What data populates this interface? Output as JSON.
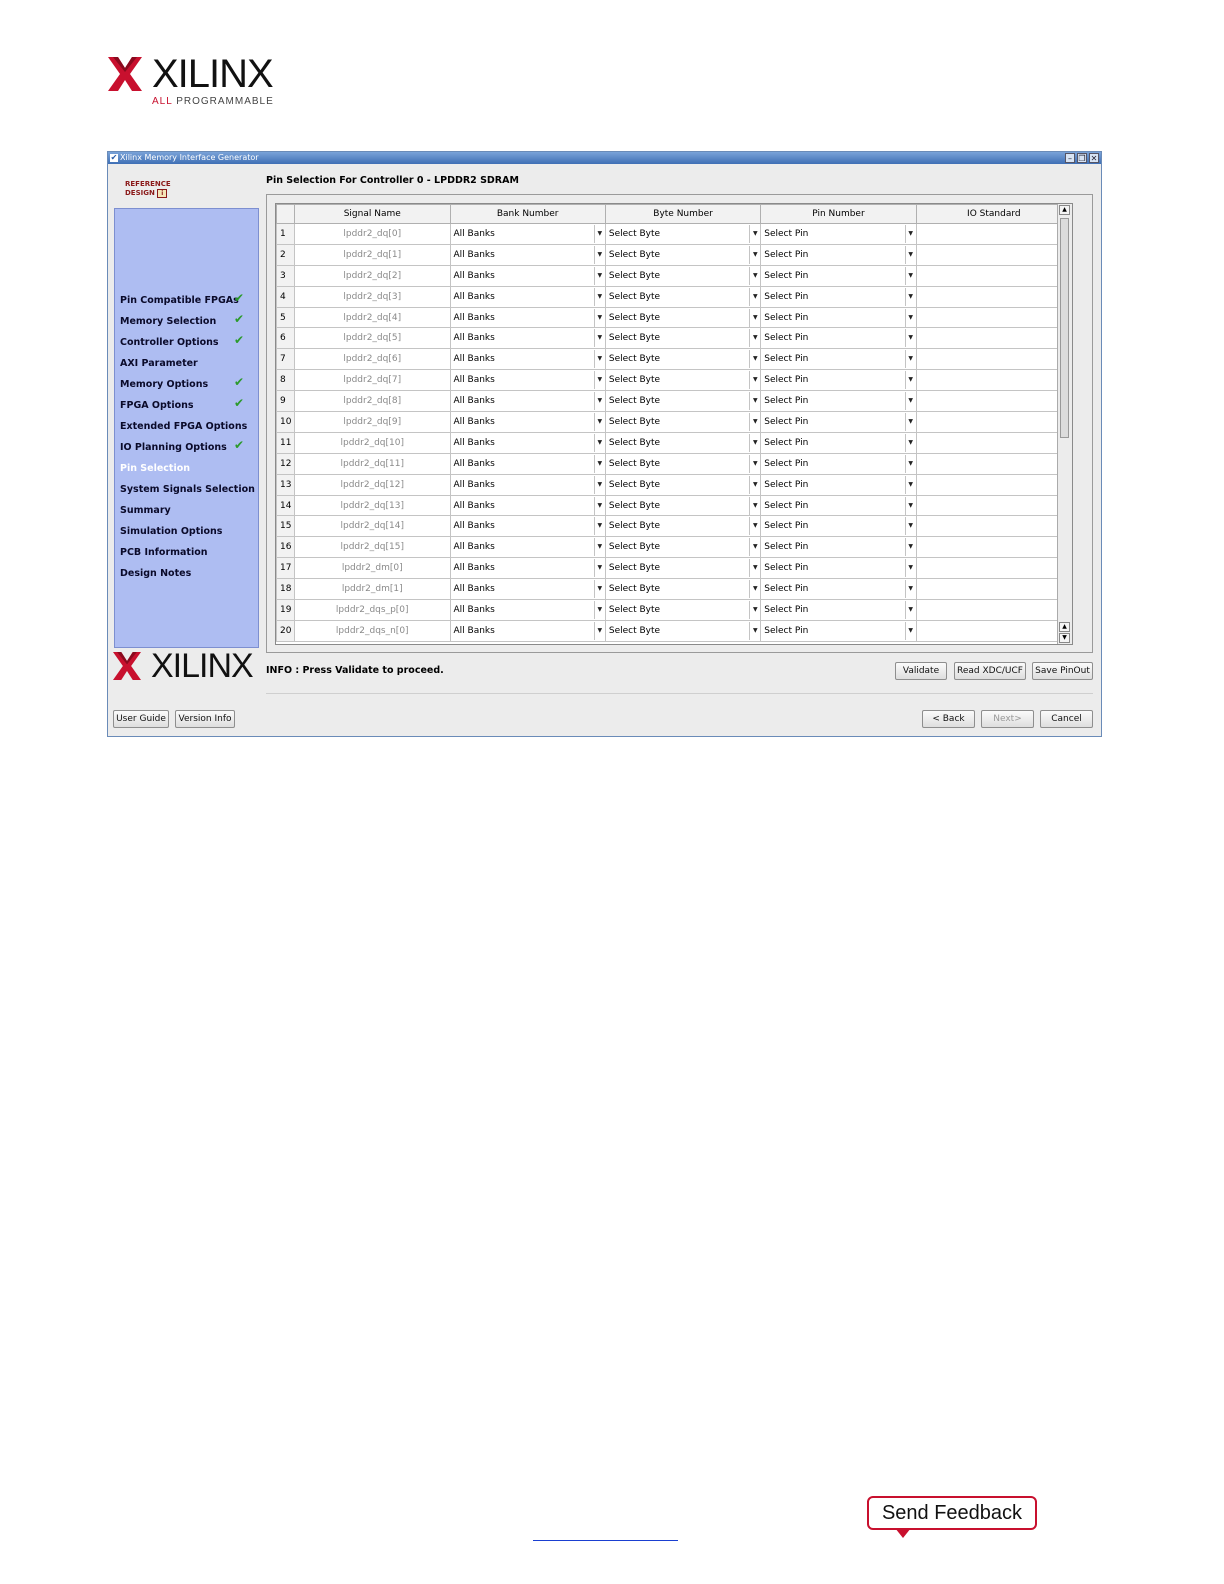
{
  "page": {
    "logo_word": "XILINX",
    "logo_tag_red": "ALL",
    "logo_tag_rest": " PROGRAMMABLE",
    "feedback": "Send Feedback"
  },
  "window": {
    "title": "Xilinx Memory Interface Generator",
    "reference": [
      "REFERENCE",
      "DESIGN"
    ],
    "heading": "Pin Selection For Controller 0 - LPDDR2 SDRAM",
    "info": "INFO : Press Validate to proceed.",
    "logo_word": "XILINX"
  },
  "sidebar": {
    "items": [
      {
        "label": "Pin Compatible FPGAs",
        "done": true
      },
      {
        "label": "Memory Selection",
        "done": true
      },
      {
        "label": "Controller Options",
        "done": true
      },
      {
        "label": "AXI Parameter",
        "done": false
      },
      {
        "label": "Memory Options",
        "done": true
      },
      {
        "label": "FPGA Options",
        "done": true
      },
      {
        "label": "Extended FPGA Options",
        "done": false
      },
      {
        "label": "IO Planning Options",
        "done": true
      },
      {
        "label": "Pin Selection",
        "done": false,
        "current": true
      },
      {
        "label": "System Signals Selection",
        "done": false
      },
      {
        "label": "Summary",
        "done": false
      },
      {
        "label": "Simulation Options",
        "done": false
      },
      {
        "label": "PCB Information",
        "done": false
      },
      {
        "label": "Design Notes",
        "done": false
      }
    ]
  },
  "table": {
    "columns": [
      "",
      "Signal Name",
      "Bank Number",
      "Byte Number",
      "Pin Number",
      "IO Standard"
    ],
    "rows": [
      {
        "num": "1",
        "signal": "lpddr2_dq[0]",
        "bank": "All Banks",
        "byte": "Select Byte",
        "pin": "Select Pin",
        "io": ""
      },
      {
        "num": "2",
        "signal": "lpddr2_dq[1]",
        "bank": "All Banks",
        "byte": "Select Byte",
        "pin": "Select Pin",
        "io": ""
      },
      {
        "num": "3",
        "signal": "lpddr2_dq[2]",
        "bank": "All Banks",
        "byte": "Select Byte",
        "pin": "Select Pin",
        "io": ""
      },
      {
        "num": "4",
        "signal": "lpddr2_dq[3]",
        "bank": "All Banks",
        "byte": "Select Byte",
        "pin": "Select Pin",
        "io": ""
      },
      {
        "num": "5",
        "signal": "lpddr2_dq[4]",
        "bank": "All Banks",
        "byte": "Select Byte",
        "pin": "Select Pin",
        "io": ""
      },
      {
        "num": "6",
        "signal": "lpddr2_dq[5]",
        "bank": "All Banks",
        "byte": "Select Byte",
        "pin": "Select Pin",
        "io": ""
      },
      {
        "num": "7",
        "signal": "lpddr2_dq[6]",
        "bank": "All Banks",
        "byte": "Select Byte",
        "pin": "Select Pin",
        "io": ""
      },
      {
        "num": "8",
        "signal": "lpddr2_dq[7]",
        "bank": "All Banks",
        "byte": "Select Byte",
        "pin": "Select Pin",
        "io": ""
      },
      {
        "num": "9",
        "signal": "lpddr2_dq[8]",
        "bank": "All Banks",
        "byte": "Select Byte",
        "pin": "Select Pin",
        "io": ""
      },
      {
        "num": "10",
        "signal": "lpddr2_dq[9]",
        "bank": "All Banks",
        "byte": "Select Byte",
        "pin": "Select Pin",
        "io": ""
      },
      {
        "num": "11",
        "signal": "lpddr2_dq[10]",
        "bank": "All Banks",
        "byte": "Select Byte",
        "pin": "Select Pin",
        "io": ""
      },
      {
        "num": "12",
        "signal": "lpddr2_dq[11]",
        "bank": "All Banks",
        "byte": "Select Byte",
        "pin": "Select Pin",
        "io": ""
      },
      {
        "num": "13",
        "signal": "lpddr2_dq[12]",
        "bank": "All Banks",
        "byte": "Select Byte",
        "pin": "Select Pin",
        "io": ""
      },
      {
        "num": "14",
        "signal": "lpddr2_dq[13]",
        "bank": "All Banks",
        "byte": "Select Byte",
        "pin": "Select Pin",
        "io": ""
      },
      {
        "num": "15",
        "signal": "lpddr2_dq[14]",
        "bank": "All Banks",
        "byte": "Select Byte",
        "pin": "Select Pin",
        "io": ""
      },
      {
        "num": "16",
        "signal": "lpddr2_dq[15]",
        "bank": "All Banks",
        "byte": "Select Byte",
        "pin": "Select Pin",
        "io": ""
      },
      {
        "num": "17",
        "signal": "lpddr2_dm[0]",
        "bank": "All Banks",
        "byte": "Select Byte",
        "pin": "Select Pin",
        "io": ""
      },
      {
        "num": "18",
        "signal": "lpddr2_dm[1]",
        "bank": "All Banks",
        "byte": "Select Byte",
        "pin": "Select Pin",
        "io": ""
      },
      {
        "num": "19",
        "signal": "lpddr2_dqs_p[0]",
        "bank": "All Banks",
        "byte": "Select Byte",
        "pin": "Select Pin",
        "io": ""
      },
      {
        "num": "20",
        "signal": "lpddr2_dqs_n[0]",
        "bank": "All Banks",
        "byte": "Select Byte",
        "pin": "Select Pin",
        "io": ""
      }
    ]
  },
  "buttons": {
    "validate": "Validate",
    "read_xdc": "Read XDC/UCF",
    "save_pinout": "Save PinOut",
    "user_guide": "User Guide",
    "version_info": "Version Info",
    "back": "< Back",
    "next": "Next>",
    "cancel": "Cancel"
  },
  "colors": {
    "xilinx_red": "#c8102e",
    "sidebar_bg": "#aebdf2",
    "check_green": "#2b9a2b",
    "title_bar": "#3f6fb5"
  }
}
